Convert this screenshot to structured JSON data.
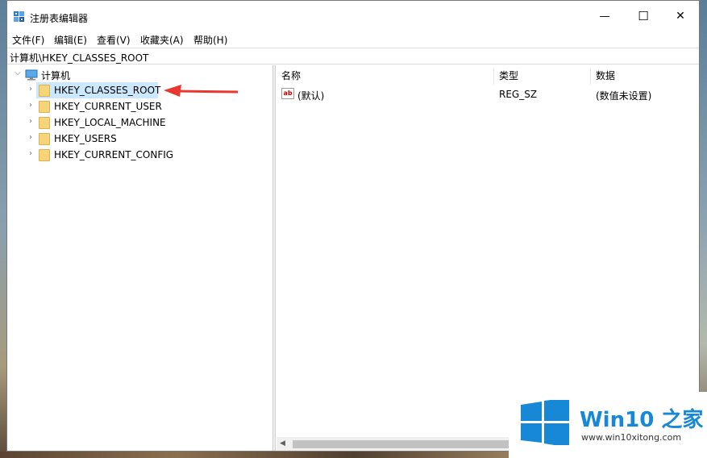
{
  "window": {
    "title": "注册表编辑器",
    "minimize_glyph": "—",
    "maximize_glyph": "☐",
    "close_glyph": "✕"
  },
  "menu": [
    {
      "label": "文件(F)"
    },
    {
      "label": "编辑(E)"
    },
    {
      "label": "查看(V)"
    },
    {
      "label": "收藏夹(A)"
    },
    {
      "label": "帮助(H)"
    }
  ],
  "address": {
    "path": "计算机\\HKEY_CLASSES_ROOT"
  },
  "tree": {
    "root": {
      "label": "计算机",
      "expanded": true,
      "icon": "computer-icon"
    },
    "items": [
      {
        "label": "HKEY_CLASSES_ROOT",
        "selected": true
      },
      {
        "label": "HKEY_CURRENT_USER",
        "selected": false
      },
      {
        "label": "HKEY_LOCAL_MACHINE",
        "selected": false
      },
      {
        "label": "HKEY_USERS",
        "selected": false
      },
      {
        "label": "HKEY_CURRENT_CONFIG",
        "selected": false
      }
    ]
  },
  "list": {
    "columns": [
      "名称",
      "类型",
      "数据"
    ],
    "rows": [
      {
        "name": "(默认)",
        "type": "REG_SZ",
        "data": "(数值未设置)",
        "icon": "string-value-icon",
        "icon_text": "ab"
      }
    ]
  },
  "annotation": {
    "color": "#e8382f",
    "icon": "red-arrow-pointing-left"
  },
  "watermark": {
    "brand": "Win10 之家",
    "url": "www.win10xitong.com",
    "logo_color": "#1688d6"
  }
}
